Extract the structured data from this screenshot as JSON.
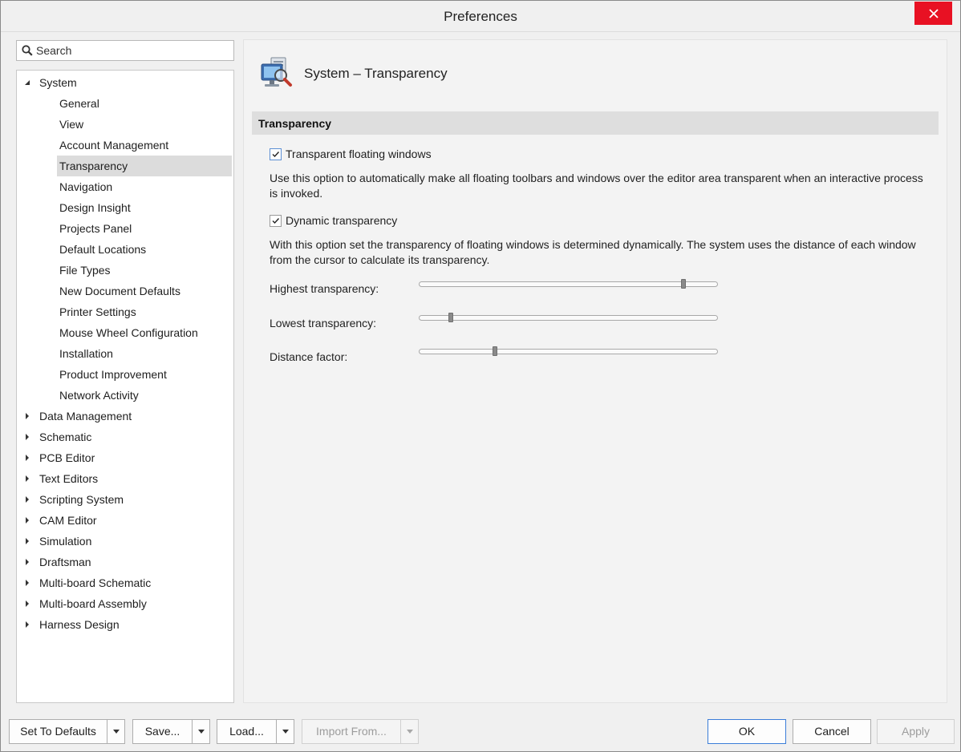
{
  "window": {
    "title": "Preferences"
  },
  "search": {
    "placeholder": "Search"
  },
  "tree": {
    "system": {
      "label": "System",
      "children": [
        "General",
        "View",
        "Account Management",
        "Transparency",
        "Navigation",
        "Design Insight",
        "Projects Panel",
        "Default Locations",
        "File Types",
        "New Document Defaults",
        "Printer Settings",
        "Mouse Wheel Configuration",
        "Installation",
        "Product Improvement",
        "Network Activity"
      ],
      "selected": "Transparency"
    },
    "categories": [
      "Data Management",
      "Schematic",
      "PCB Editor",
      "Text Editors",
      "Scripting System",
      "CAM Editor",
      "Simulation",
      "Draftsman",
      "Multi-board Schematic",
      "Multi-board Assembly",
      "Harness Design"
    ]
  },
  "page": {
    "title": "System – Transparency",
    "section": "Transparency",
    "options": [
      {
        "label": "Transparent floating windows",
        "checked": true,
        "description": "Use this option to automatically make all floating toolbars and windows over the editor area transparent when an interactive process is invoked."
      },
      {
        "label": "Dynamic transparency",
        "checked": true,
        "description": "With this option set the transparency of floating windows is determined dynamically. The system uses the distance of each window from the cursor to calculate its transparency."
      }
    ],
    "sliders": [
      {
        "label": "Highest transparency:",
        "value_fraction": 0.89
      },
      {
        "label": "Lowest transparency:",
        "value_fraction": 0.1
      },
      {
        "label": "Distance factor:",
        "value_fraction": 0.25
      }
    ]
  },
  "buttons": {
    "set_defaults": "Set To Defaults",
    "save": "Save...",
    "load": "Load...",
    "import_from": "Import From...",
    "ok": "OK",
    "cancel": "Cancel",
    "apply": "Apply"
  },
  "colors": {
    "close_button": "#e81123",
    "accent": "#3b7dd8",
    "selected_row": "#dcdcdc"
  },
  "icons": {
    "close": "close-icon",
    "search": "search-icon",
    "page": "system-transparency-icon",
    "expand": "triangle-right-icon",
    "collapse": "triangle-down-icon",
    "dropdown": "caret-down-icon"
  }
}
